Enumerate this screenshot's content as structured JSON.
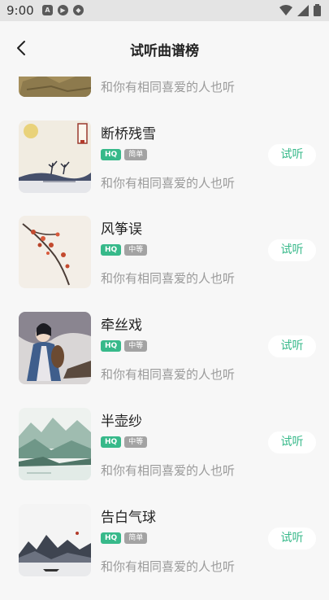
{
  "status": {
    "time": "9:00"
  },
  "header": {
    "title": "试听曲谱榜"
  },
  "partial_item": {
    "desc": "和你有相同喜爱的人也听"
  },
  "items": [
    {
      "name": "断桥残雪",
      "hq": "HQ",
      "level": "简单",
      "desc": "和你有相同喜爱的人也听",
      "button": "试听"
    },
    {
      "name": "风筝误",
      "hq": "HQ",
      "level": "中等",
      "desc": "和你有相同喜爱的人也听",
      "button": "试听"
    },
    {
      "name": "牵丝戏",
      "hq": "HQ",
      "level": "中等",
      "desc": "和你有相同喜爱的人也听",
      "button": "试听"
    },
    {
      "name": "半壶纱",
      "hq": "HQ",
      "level": "中等",
      "desc": "和你有相同喜爱的人也听",
      "button": "试听"
    },
    {
      "name": "告白气球",
      "hq": "HQ",
      "level": "简单",
      "desc": "和你有相同喜爱的人也听",
      "button": "试听"
    }
  ],
  "colors": {
    "accent": "#37b98a",
    "tag_gray": "#a3a3a3",
    "background": "#f7f7f7"
  }
}
